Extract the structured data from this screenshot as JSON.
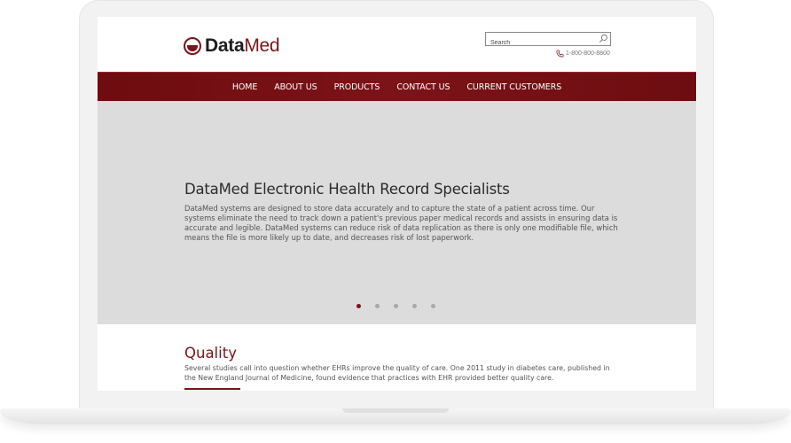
{
  "logo": {
    "text_bold": "Data",
    "text_light": "Med"
  },
  "search": {
    "placeholder": "Search"
  },
  "contact": {
    "phone": "1-800-800-8800"
  },
  "nav": {
    "items": [
      {
        "label": "HOME"
      },
      {
        "label": "ABOUT US"
      },
      {
        "label": "PRODUCTS"
      },
      {
        "label": "CONTACT US"
      },
      {
        "label": "CURRENT CUSTOMERS"
      }
    ]
  },
  "hero": {
    "title": "DataMed Electronic Health Record Specialists",
    "body": "DataMed systems are designed to store data accurately and to capture the state of a patient across time. Our systems eliminate the need to track down a patient's previous paper medical records and assists in ensuring data is accurate and legible. DataMed systems can reduce risk of data replication as there is only one modifiable file, which means the file is more likely up to date, and decreases risk of lost paperwork.",
    "slides": 5,
    "active_slide": 1
  },
  "quality": {
    "title": "Quality",
    "body": "Several studies call into question whether EHRs improve the quality of care. One 2011 study in diabetes care, published in the New England Journal of Medicine, found evidence that practices with EHR provided better quality care."
  },
  "colors": {
    "brand": "#7a1419",
    "hero_bg": "#dcdcdc"
  },
  "icons": {
    "search": "search-icon",
    "phone": "phone-icon"
  }
}
